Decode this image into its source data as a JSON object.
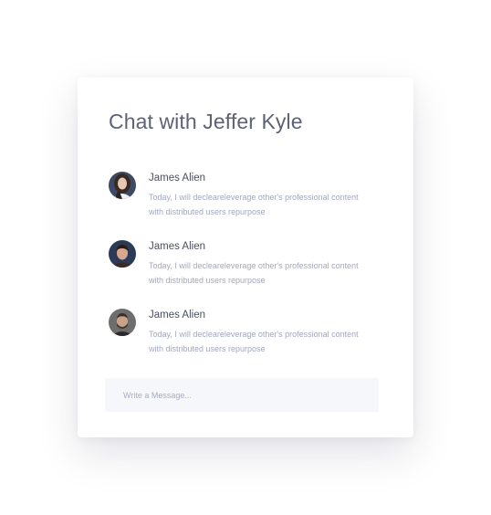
{
  "chat": {
    "title": "Chat with Jeffer Kyle",
    "messages": [
      {
        "name": "James Alien",
        "text_line1": "Today, I will declearelеverage other's professional content",
        "text_line2": "with distributed users repurpose",
        "avatar": "woman-photo-avatar"
      },
      {
        "name": "James Alien",
        "text_line1": "Today, I will declearelеverage other's professional content",
        "text_line2": "with distributed users repurpose",
        "avatar": "man-dark-hair-photo-avatar"
      },
      {
        "name": "James Alien",
        "text_line1": "Today, I will declearelеverage other's professional content",
        "text_line2": "with distributed users repurpose",
        "avatar": "man-beard-photo-avatar"
      }
    ],
    "input": {
      "placeholder": "Write a Message..."
    }
  },
  "colors": {
    "title": "#5d6276",
    "name": "#4a4f61",
    "message_text": "#a3a7bf",
    "input_background": "#f6f7fb"
  }
}
